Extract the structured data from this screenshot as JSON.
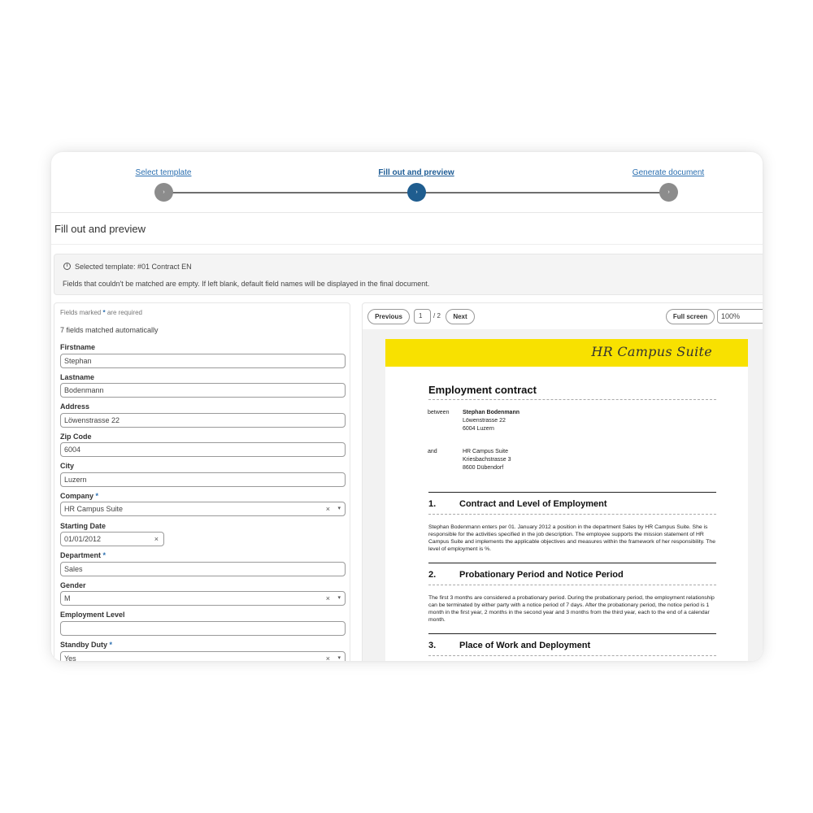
{
  "stepper": {
    "steps": [
      {
        "label": "Select template",
        "dot": "›"
      },
      {
        "label": "Fill out and preview",
        "dot": "›"
      },
      {
        "label": "Generate document",
        "dot": "›"
      }
    ],
    "active_step": 2,
    "active_color": "#1f5d8f",
    "inactive_color": "#8c8c8c"
  },
  "page_title": "Fill out and preview",
  "info": {
    "icon": "info-icon",
    "selected_template": "Selected template: #01 Contract EN",
    "note": "Fields that couldn't be matched are empty. If left blank, default field names will be displayed in the final document."
  },
  "form": {
    "required_prefix": "Fields marked",
    "required_star": "*",
    "required_suffix": "are required",
    "matched_text": "7 fields matched automatically",
    "fields": [
      {
        "label": "Firstname",
        "value": "Stephan"
      },
      {
        "label": "Lastname",
        "value": "Bodenmann"
      },
      {
        "label": "Address",
        "value": "Löwenstrasse 22"
      },
      {
        "label": "Zip Code",
        "value": "6004"
      },
      {
        "label": "City",
        "value": "Luzern"
      },
      {
        "label": "Company",
        "value": "HR Campus Suite",
        "required": "*"
      },
      {
        "label": "Starting Date",
        "value": "01/01/2012"
      },
      {
        "label": "Department",
        "value": "Sales",
        "required": "*"
      },
      {
        "label": "Gender",
        "value": "M"
      },
      {
        "label": "Employment Level",
        "value": ""
      },
      {
        "label": "Standby Duty",
        "value": "Yes",
        "required": "*"
      }
    ],
    "clear_glyph": "×",
    "caret_glyph": "▾",
    "accent": "#2b6fb0"
  },
  "preview": {
    "prev_label": "Previous",
    "next_label": "Next",
    "page": "1",
    "total": "/ 2",
    "fullscreen_label": "Full screen",
    "zoom": "100%"
  },
  "document": {
    "banner_color": "#f8e100",
    "logo_text": "HR Campus Suite",
    "title": "Employment contract",
    "between_label": "between",
    "employee_name": "Stephan Bodenmann",
    "employee_street": "Löwenstrasse 22",
    "employee_city": "6004 Luzern",
    "and_label": "and",
    "company_name": "HR Campus Suite",
    "company_street": "Kriesbachstrasse 3",
    "company_city": "8600 Dübendorf",
    "sections": [
      {
        "num": "1.",
        "title": "Contract and Level of Employment",
        "body": "Stephan Bodenmann enters per 01. January 2012 a position in the department Sales by HR Campus Suite. She is responsible for the activities specified in the job description. The employee supports the mission statement of HR Campus Suite and implements the applicable objectives and measures within the framework of her responsibility. The level of employment is %."
      },
      {
        "num": "2.",
        "title": "Probationary Period and Notice Period",
        "body": "The first 3 months are considered a probationary period. During the probationary period, the employment relationship can be terminated by either party with a notice period of 7 days. After the probationary period, the notice period is 1 month in the first year, 2 months in the second year and 3 months from the third year, each to the end of a calendar month."
      },
      {
        "num": "3.",
        "title": "Place of Work and Deployment",
        "body": ""
      }
    ]
  }
}
